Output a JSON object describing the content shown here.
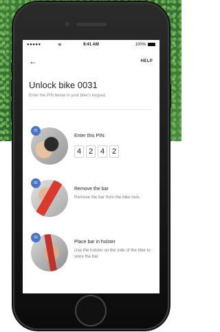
{
  "status_bar": {
    "signal": "●●●●●",
    "wifi": "≋",
    "time": "9:41 AM",
    "battery_text": "100%"
  },
  "nav": {
    "back_glyph": "←",
    "help_label": "HELP"
  },
  "header": {
    "title": "Unlock bike 0031",
    "subtitle": "Enter the PIN below in your bike’s keypad."
  },
  "steps": [
    {
      "number": "01",
      "title": "Enter this PIN:",
      "pin": [
        "4",
        "2",
        "4",
        "2"
      ]
    },
    {
      "number": "02",
      "title": "Remove the bar",
      "text": "Remove the bar from the bike lock."
    },
    {
      "number": "03",
      "title": "Place bar in holster",
      "text": "Use the holster on the side of the bike to store the bar."
    }
  ],
  "colors": {
    "badge": "#4a75c7",
    "grass": "#3f7f35"
  }
}
